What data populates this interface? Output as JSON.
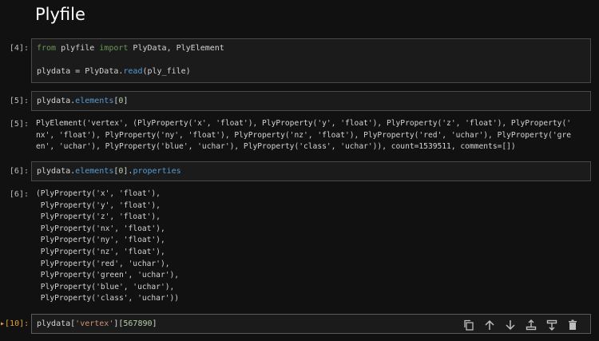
{
  "heading": "Plyfile",
  "cells": [
    {
      "prompt": "[4]:",
      "code": {
        "line1": [
          "from",
          " plyfile ",
          "import",
          " PlyData, PlyElement"
        ],
        "line3": [
          "plydata ",
          "=",
          " PlyData.",
          "read",
          "(ply_file)"
        ]
      }
    },
    {
      "prompt": "[5]:",
      "code": {
        "parts": [
          "plydata.",
          "elements",
          "[",
          "0",
          "]"
        ]
      },
      "out_prompt": "[5]:",
      "output": "PlyElement('vertex', (PlyProperty('x', 'float'), PlyProperty('y', 'float'), PlyProperty('z', 'float'), PlyProperty('\nnx', 'float'), PlyProperty('ny', 'float'), PlyProperty('nz', 'float'), PlyProperty('red', 'uchar'), PlyProperty('gre\nen', 'uchar'), PlyProperty('blue', 'uchar'), PlyProperty('class', 'uchar')), count=1539511, comments=[])"
    },
    {
      "prompt": "[6]:",
      "code": {
        "parts": [
          "plydata.",
          "elements",
          "[",
          "0",
          "].",
          "properties"
        ]
      },
      "out_prompt": "[6]:",
      "output": "(PlyProperty('x', 'float'),\n PlyProperty('y', 'float'),\n PlyProperty('z', 'float'),\n PlyProperty('nx', 'float'),\n PlyProperty('ny', 'float'),\n PlyProperty('nz', 'float'),\n PlyProperty('red', 'uchar'),\n PlyProperty('green', 'uchar'),\n PlyProperty('blue', 'uchar'),\n PlyProperty('class', 'uchar'))"
    },
    {
      "prompt": "[10]:",
      "active_marker": "▸",
      "code": {
        "parts": [
          "plydata[",
          "'vertex'",
          "][",
          "567890",
          "]"
        ]
      }
    }
  ],
  "toolbar": [
    {
      "name": "copy-cell-icon"
    },
    {
      "name": "move-up-icon"
    },
    {
      "name": "move-down-icon"
    },
    {
      "name": "insert-above-icon"
    },
    {
      "name": "insert-below-icon"
    },
    {
      "name": "delete-cell-icon"
    }
  ]
}
